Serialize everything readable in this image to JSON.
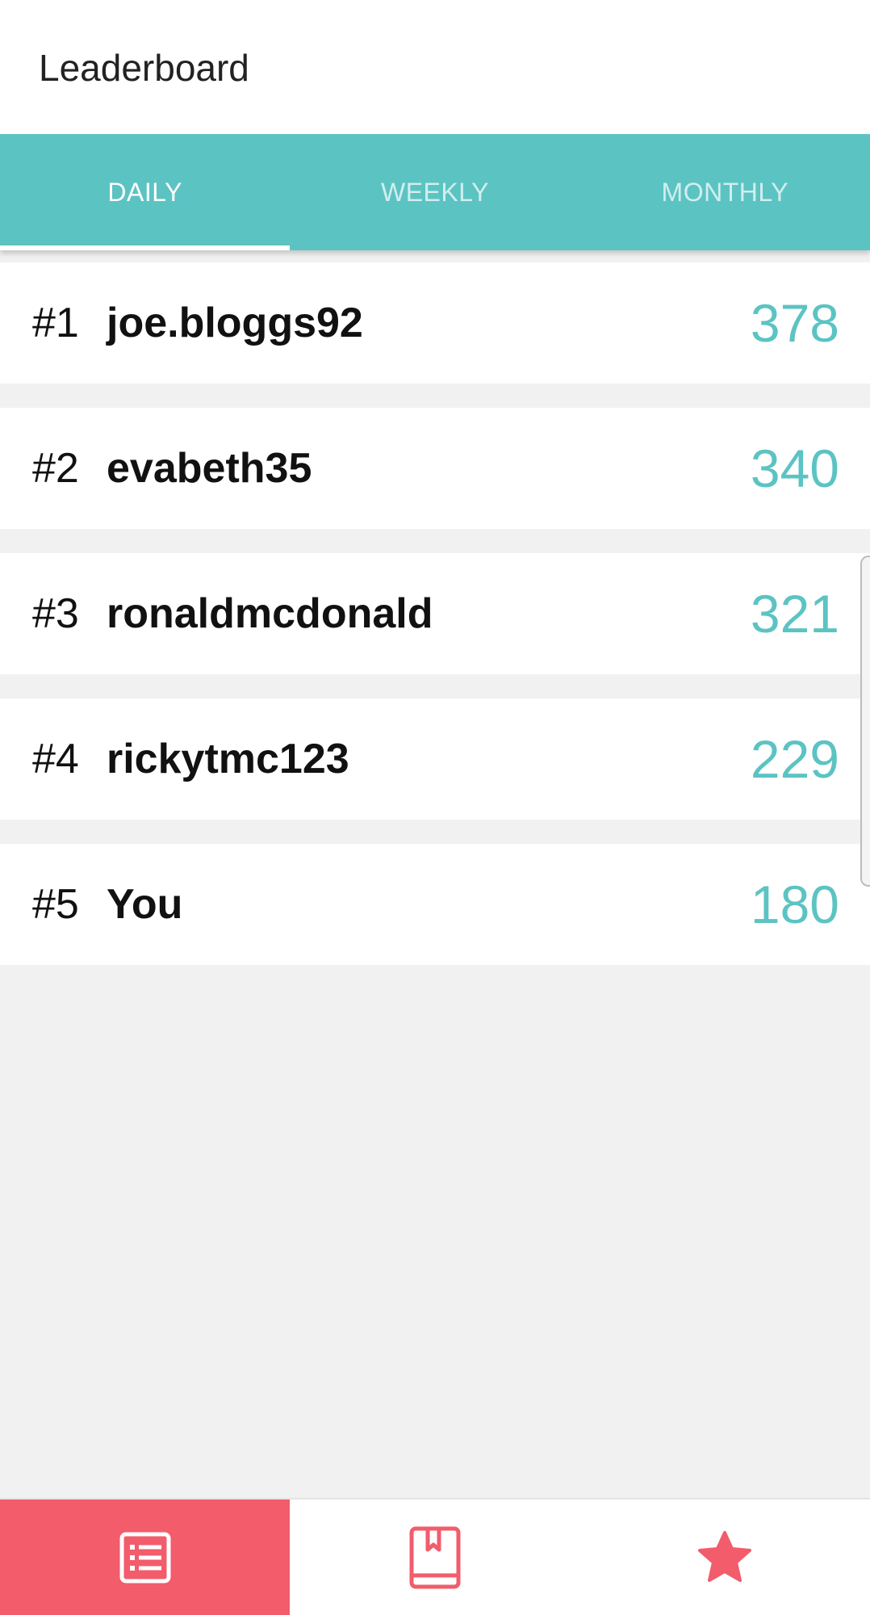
{
  "app_bar": {
    "title": "Leaderboard"
  },
  "tabs": [
    {
      "label": "DAILY",
      "active": true
    },
    {
      "label": "WEEKLY",
      "active": false
    },
    {
      "label": "MONTHLY",
      "active": false
    }
  ],
  "leaderboard": [
    {
      "rank": "#1",
      "username": "joe.bloggs92",
      "score": "378"
    },
    {
      "rank": "#2",
      "username": "evabeth35",
      "score": "340"
    },
    {
      "rank": "#3",
      "username": "ronaldmcdonald",
      "score": "321"
    },
    {
      "rank": "#4",
      "username": "rickytmc123",
      "score": "229"
    },
    {
      "rank": "#5",
      "username": "You",
      "score": "180"
    }
  ],
  "bottom_nav": [
    {
      "icon": "list-icon",
      "active": true
    },
    {
      "icon": "book-icon",
      "active": false
    },
    {
      "icon": "star-icon",
      "active": false
    }
  ],
  "colors": {
    "accent_teal": "#5cc3c3",
    "accent_red": "#f25c6b",
    "background": "#f1f1f1"
  }
}
